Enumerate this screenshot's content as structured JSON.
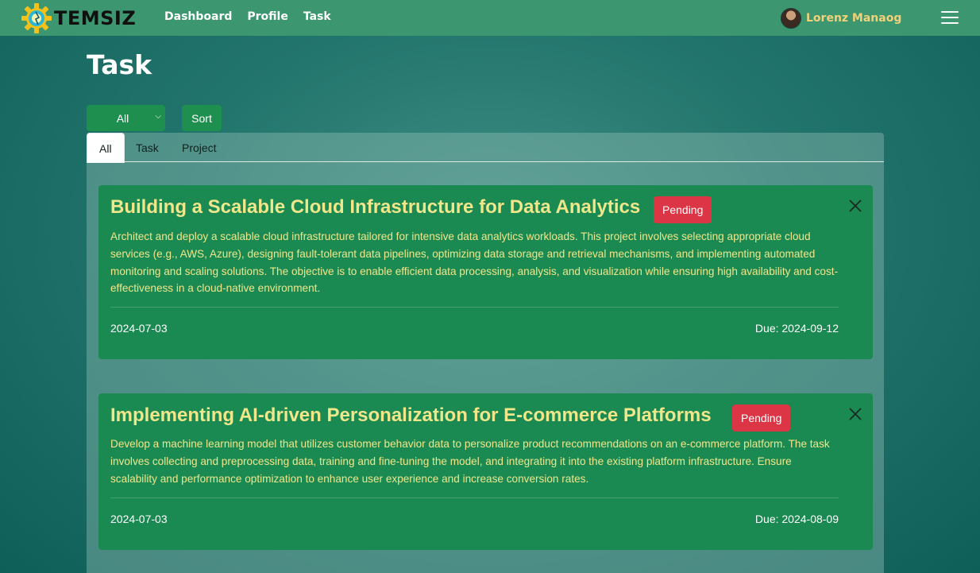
{
  "navbar": {
    "brand": "TEMSIZ",
    "links": [
      "Dashboard",
      "Profile",
      "Task"
    ],
    "user_name": "Lorenz Manaog"
  },
  "page": {
    "title": "Task"
  },
  "controls": {
    "filter_value": "All",
    "sort_label": "Sort"
  },
  "tabs": [
    "All",
    "Task",
    "Project"
  ],
  "active_tab": "All",
  "cards": [
    {
      "title": "Building a Scalable Cloud Infrastructure for Data Analytics",
      "status": "Pending",
      "description": "Architect and deploy a scalable cloud infrastructure tailored for intensive data analytics workloads. This project involves selecting appropriate cloud services (e.g., AWS, Azure), designing fault-tolerant data pipelines, optimizing data storage and retrieval mechanisms, and implementing automated monitoring and scaling solutions. The objective is to enable efficient data processing, analysis, and visualization while ensuring high availability and cost-effectiveness in a cloud-native environment.",
      "date": "2024-07-03",
      "due": "Due: 2024-09-12"
    },
    {
      "title": "Implementing AI-driven Personalization for E-commerce Platforms",
      "status": "Pending",
      "description": "Develop a machine learning model that utilizes customer behavior data to personalize product recommendations on an e-commerce platform. The task involves collecting and preprocessing data, training and fine-tuning the model, and integrating it into the existing platform infrastructure. Ensure scalability and performance optimization to enhance user experience and increase conversion rates.",
      "date": "2024-07-03",
      "due": "Due: 2024-08-09"
    }
  ],
  "colors": {
    "navbar": "#3c9670",
    "card": "#1b8a52",
    "card_text": "#f0e68a",
    "badge": "#dc3545",
    "user_name": "#f0d27a"
  }
}
